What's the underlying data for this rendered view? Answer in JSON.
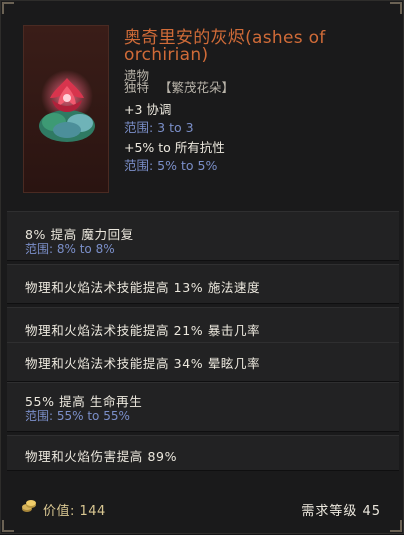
{
  "item": {
    "title": "奥奇里安的灰烬(ashes of orchirian)",
    "category": "遗物",
    "rarity": "独特",
    "set_tag": "【繁茂花朵】"
  },
  "implicits": [
    {
      "text": "+3 协调",
      "range": "范围: 3 to 3"
    },
    {
      "text": "+5% to 所有抗性",
      "range": "范围: 5% to 5%"
    }
  ],
  "mods": [
    {
      "text": "8% 提高 魔力回复",
      "range": "范围: 8% to 8%"
    },
    {
      "text": "物理和火焰法术技能提高 13% 施法速度"
    },
    {
      "text": "物理和火焰法术技能提高 21% 暴击几率"
    },
    {
      "text": "物理和火焰法术技能提高 34% 晕眩几率"
    },
    {
      "text": "55% 提高 生命再生",
      "range": "范围: 55% to 55%"
    },
    {
      "text": "物理和火焰伤害提高 89%"
    }
  ],
  "footer": {
    "value": "价值: 144",
    "requirement": "需求等级 45"
  },
  "icons": {
    "item_icon": "flower-relic-icon",
    "coin_icon": "coin-stack-icon"
  },
  "colors": {
    "title": "#d06b38",
    "range": "#7b8fc9",
    "value": "#d9c792"
  }
}
